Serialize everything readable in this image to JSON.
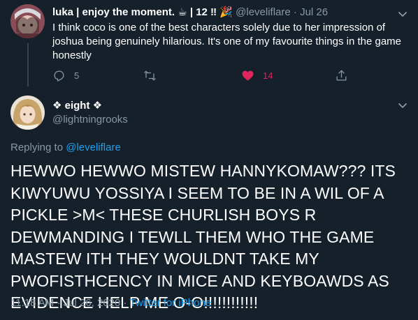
{
  "parent_tweet": {
    "display_name": "luka | enjoy the moment. ☕ | 12 ‼ 🎉",
    "handle": "@leveliflare",
    "separator": "·",
    "date": "Jul 26",
    "text": "I think coco is one of the best characters solely due to her impression of joshua being genuinely hilarious. It's one of my favourite things in the game honestly",
    "actions": {
      "reply_count": "5",
      "retweet_count": "",
      "like_count": "14",
      "like_color": "#e0245e"
    }
  },
  "main_tweet": {
    "display_name": "❖ eight ❖",
    "handle": "@lightningrooks",
    "replying_prefix": "Replying to",
    "replying_to": "@leveliflare",
    "text": "HEWWO HEWWO MISTEW HANNYKOMAW??? ITS KIWYUWU YOSSIYA I SEEM TO BE IN A WIL OF A PICKLE >M< THESE CHURLISH BOYS R DEWMANDING I TEWLL THEM WHO THE GAME MASTEW ITH THEY WOULDNT TAKE MY PWOFISTHCENCY IN MICE AND KEYBOAWDS AS EVIDENCE HELP ME O-O!!!!!!!!!!!!",
    "time": "11:18 AM",
    "separator": "·",
    "date": "Jul 26, 2020",
    "source": "Twitter for iPhone"
  },
  "icons": {
    "reply": "reply-icon",
    "retweet": "retweet-icon",
    "like": "heart-icon",
    "share": "share-icon",
    "more": "chevron-down-icon"
  },
  "colors": {
    "background": "#15202b",
    "text": "#ffffff",
    "secondary": "#8899a6",
    "accent": "#1da1f2",
    "thread_line": "#38444d"
  }
}
